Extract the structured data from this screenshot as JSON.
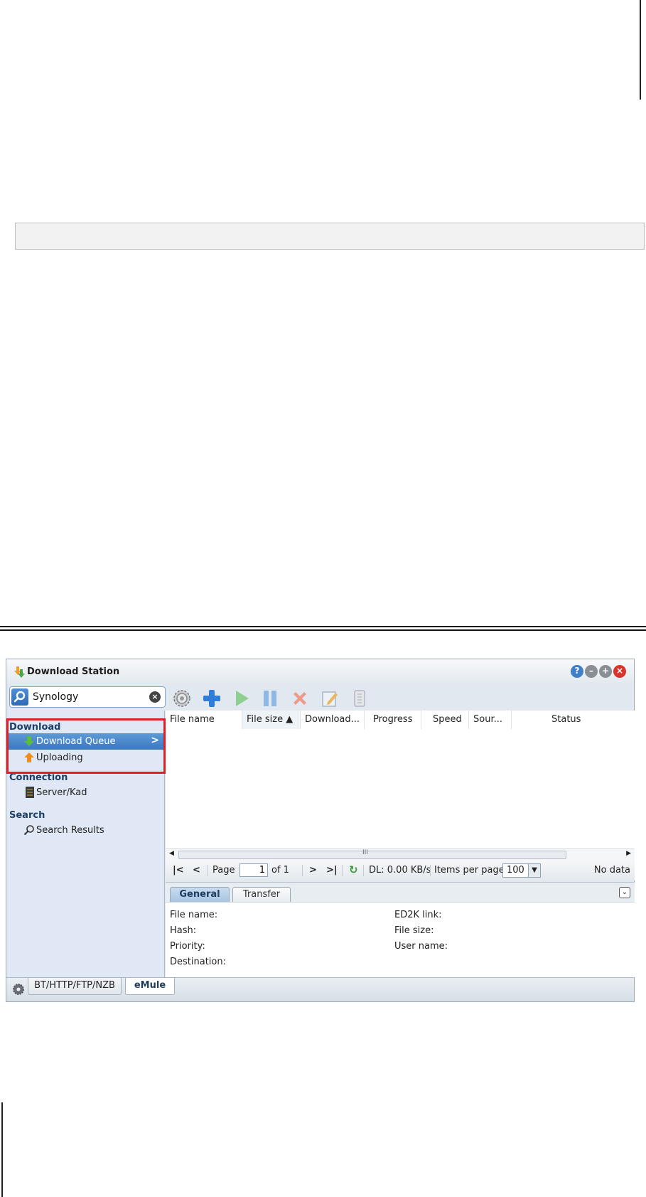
{
  "window": {
    "title": "Download Station",
    "search": {
      "value": "Synology",
      "placeholder": ""
    }
  },
  "toolbar": {
    "icons": [
      "settings-gear-icon",
      "add-icon",
      "start-icon",
      "pause-icon",
      "delete-icon",
      "edit-icon",
      "clear-icon"
    ]
  },
  "sidebar": {
    "sections": [
      {
        "title": "Download",
        "items": [
          {
            "label": "Download Queue",
            "selected": true
          },
          {
            "label": "Uploading"
          }
        ]
      },
      {
        "title": "Connection",
        "items": [
          {
            "label": "Server/Kad"
          }
        ]
      },
      {
        "title": "Search",
        "items": [
          {
            "label": "Search Results"
          }
        ]
      }
    ]
  },
  "grid": {
    "columns": [
      "File name",
      "File size ▲",
      "Download...",
      "Progress",
      "Speed",
      "Sour...",
      "Status"
    ],
    "rows": []
  },
  "pager": {
    "page_label": "Page",
    "page_value": "1",
    "of_label": "of 1",
    "dl_rate": "DL: 0.00 KB/s",
    "items_per_page_label": "Items per page:",
    "items_per_page_value": "100",
    "status": "No data",
    "scroll_grip": "III"
  },
  "detail": {
    "tabs": [
      "General",
      "Transfer"
    ],
    "left_fields": [
      "File name:",
      "Hash:",
      "Priority:",
      "Destination:"
    ],
    "right_fields": [
      "ED2K link:",
      "File size:",
      "User name:"
    ]
  },
  "bottom_tabs": [
    "BT/HTTP/FTP/NZB",
    "eMule"
  ],
  "colors": {
    "selection": "#3c78bd",
    "highlight_box": "#e01f26",
    "section_header": "#1d3e67"
  }
}
